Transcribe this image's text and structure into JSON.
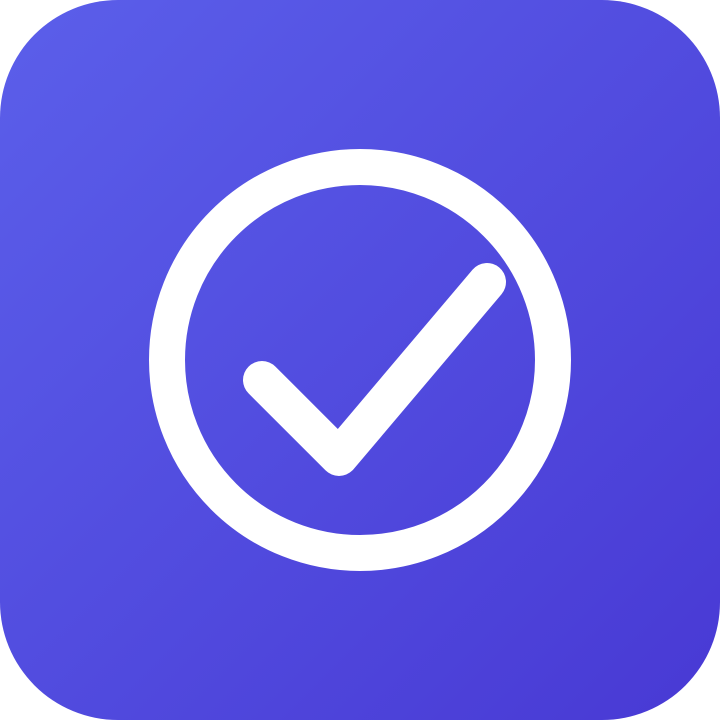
{
  "icon": {
    "name": "check-circle-icon",
    "shape": "rounded-square",
    "gradient_start": "#5B5FEA",
    "gradient_end": "#4839D4",
    "glyph_color": "#FFFFFF"
  }
}
